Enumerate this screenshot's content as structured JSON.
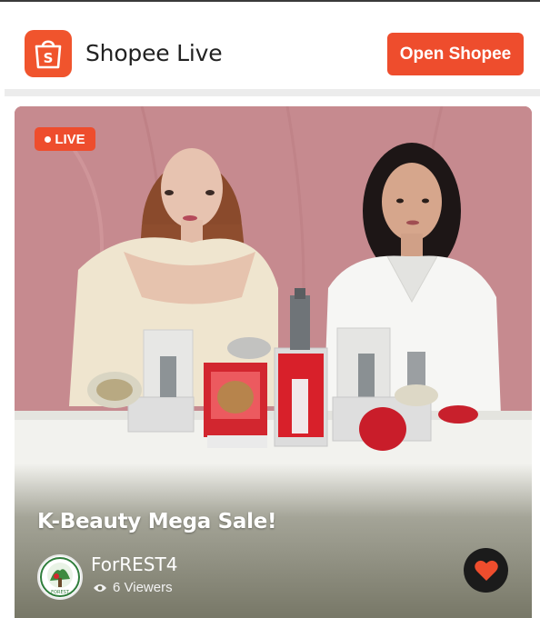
{
  "header": {
    "app_icon": "shopee-bag-icon",
    "app_title": "Shopee Live",
    "open_button_label": "Open Shopee",
    "brand_color": "#ee4d2d"
  },
  "stream": {
    "live_badge": "LIVE",
    "title": "K-Beauty Mega Sale!",
    "streamer_name": "ForREST4",
    "viewers_text": "6 Viewers",
    "viewers_icon": "eye-icon",
    "like_icon": "heart-icon",
    "avatar_icon": "streamer-logo-icon"
  }
}
